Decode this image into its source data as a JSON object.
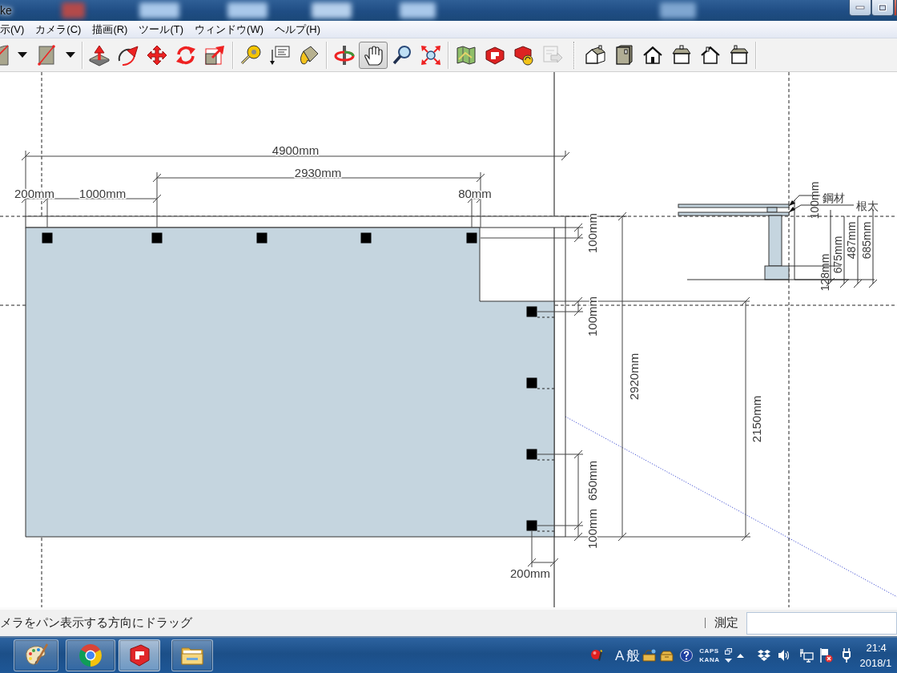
{
  "window": {
    "title": "ke"
  },
  "menu": [
    "示(V)",
    "カメラ(C)",
    "描画(R)",
    "ツール(T)",
    "ウィンドウ(W)",
    "ヘルプ(H)"
  ],
  "toolbar": {
    "groups": [
      {
        "tools": [
          {
            "kind": "arc",
            "selected": false,
            "disabled": false
          },
          {
            "kind": "dropdown",
            "selected": false,
            "disabled": false
          },
          {
            "kind": "rectangle",
            "selected": false,
            "disabled": false
          },
          {
            "kind": "dropdown",
            "selected": false,
            "disabled": false
          }
        ]
      },
      {
        "tools": [
          {
            "kind": "pushpull",
            "selected": false,
            "disabled": false
          },
          {
            "kind": "followme",
            "selected": false,
            "disabled": false
          },
          {
            "kind": "move",
            "selected": false,
            "disabled": false
          },
          {
            "kind": "rotate",
            "selected": false,
            "disabled": false
          },
          {
            "kind": "scale",
            "selected": false,
            "disabled": false
          }
        ]
      },
      {
        "tools": [
          {
            "kind": "tape",
            "selected": false,
            "disabled": false
          },
          {
            "kind": "text",
            "selected": false,
            "disabled": false
          },
          {
            "kind": "paint",
            "selected": false,
            "disabled": false
          }
        ]
      },
      {
        "tools": [
          {
            "kind": "orbit",
            "selected": false,
            "disabled": false
          },
          {
            "kind": "pan",
            "selected": true,
            "disabled": false
          },
          {
            "kind": "zoom",
            "selected": false,
            "disabled": false
          },
          {
            "kind": "zoomextents",
            "selected": false,
            "disabled": false
          }
        ]
      },
      {
        "tools": [
          {
            "kind": "location",
            "selected": false,
            "disabled": false
          },
          {
            "kind": "share",
            "selected": false,
            "disabled": false
          },
          {
            "kind": "refresh",
            "selected": false,
            "disabled": false
          },
          {
            "kind": "export",
            "selected": false,
            "disabled": true
          }
        ]
      },
      {
        "tools": [
          {
            "kind": "iso",
            "selected": false,
            "disabled": false
          },
          {
            "kind": "top",
            "selected": false,
            "disabled": false
          },
          {
            "kind": "front",
            "selected": false,
            "disabled": false
          },
          {
            "kind": "right",
            "selected": false,
            "disabled": false
          },
          {
            "kind": "back",
            "selected": false,
            "disabled": false
          },
          {
            "kind": "left",
            "selected": false,
            "disabled": false
          }
        ]
      }
    ]
  },
  "canvas": {
    "plan_dimensions": [
      "4900mm",
      "2930mm",
      "200mm",
      "1000mm",
      "80mm",
      "100mm",
      "100mm",
      "2920mm",
      "2150mm",
      "650mm",
      "100mm",
      "200mm"
    ],
    "side_view_dimensions": [
      "100mm",
      "128mm",
      "675mm",
      "487mm",
      "685mm"
    ],
    "side_view_labels": [
      "鋼材",
      "根太"
    ]
  },
  "status_bar": {
    "hint": "メラをパン表示する方向にドラッグ",
    "measurement_label": "測定"
  },
  "taskbar": {
    "apps": [
      {
        "kind": "paint",
        "selected": false
      },
      {
        "kind": "chrome",
        "selected": false
      },
      {
        "kind": "sketchup",
        "selected": true
      },
      {
        "kind": "explorer",
        "selected": false
      }
    ],
    "tray": {
      "ime_mode": "A",
      "ime_input": "般",
      "caps": "CAPS",
      "kana": "KANA"
    },
    "clock": {
      "time": "21:4",
      "date": "2018/1"
    }
  }
}
